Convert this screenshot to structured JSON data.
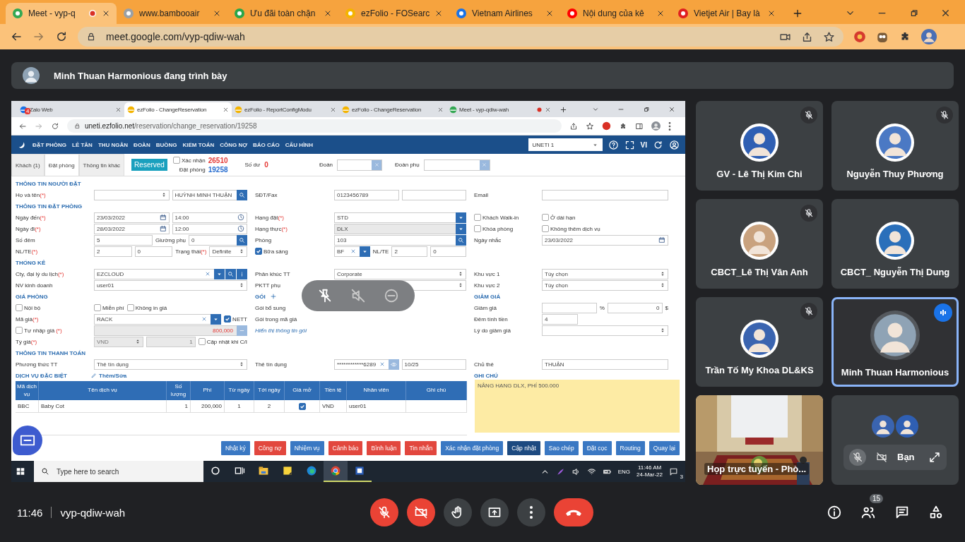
{
  "browser": {
    "tabs": [
      {
        "title": "Meet - vyp-q",
        "selected": true,
        "recording": true
      },
      {
        "title": "www.bambooair",
        "selected": false,
        "recording": false
      },
      {
        "title": "Ưu đãi toàn chặn",
        "selected": false,
        "recording": false
      },
      {
        "title": "ezFolio - FOSearc",
        "selected": false,
        "recording": false
      },
      {
        "title": "Vietnam Airlines",
        "selected": false,
        "recording": false
      },
      {
        "title": "Nội dung của kê",
        "selected": false,
        "recording": false
      },
      {
        "title": "Vietjet Air | Bay là",
        "selected": false,
        "recording": false
      }
    ],
    "url": "meet.google.com/vyp-qdiw-wah"
  },
  "presenter_banner": "Minh Thuan Harmonious đang trình bày",
  "shared_screen": {
    "browser": {
      "tabs": [
        {
          "title": "Zalo Web",
          "selected": false,
          "badge": "4",
          "recording": false
        },
        {
          "title": "ezFolio - ChangeReservation",
          "selected": true,
          "recording": false
        },
        {
          "title": "ezFolio - ReportConfigModu",
          "selected": false,
          "recording": false
        },
        {
          "title": "ezFolio - ChangeReservation",
          "selected": false,
          "recording": false
        },
        {
          "title": "Meet - vyp-qdiw-wah",
          "selected": false,
          "recording": true
        }
      ],
      "url_host": "uneti.ezfolio.net",
      "url_path": "/reservation/change_reservation/19258"
    },
    "nav": {
      "menu": [
        "ĐẶT PHÒNG",
        "LỄ TÂN",
        "THU NGÂN",
        "ĐOÀN",
        "BUỒNG",
        "KIỂM TOÁN",
        "CÔNG NỢ",
        "BÁO CÁO",
        "CẤU HÌNH"
      ],
      "property": "UNETI 1",
      "language": "VI"
    },
    "tabs": [
      {
        "label": "Khách (1)",
        "selected": false
      },
      {
        "label": "Đặt phòng",
        "selected": true
      },
      {
        "label": "Thông tin khác",
        "selected": false
      }
    ],
    "status": "Reserved",
    "confirm": {
      "label": "Xác nhận",
      "checked": false,
      "value": "26510"
    },
    "booking": {
      "label": "Đặt phòng",
      "value": "19258"
    },
    "balance": {
      "label": "Số dư",
      "value": "0"
    },
    "group_label": "Đoàn",
    "subgroup_label": "Đoàn phụ",
    "form": [
      {
        "left": {
          "label": {
            "kind": "section",
            "text": "THÔNG TIN NGƯỜI ĐẶT"
          }
        }
      },
      {
        "left": {
          "label": {
            "kind": "label",
            "text": "Họ và tên",
            "required": "(*)"
          },
          "controls": [
            {
              "kind": "select"
            },
            {
              "kind": "input",
              "value": "HUỲNH MINH THUẬN",
              "buttons": [
                {
                  "kind": "search"
                }
              ]
            }
          ]
        },
        "middle": {
          "label": {
            "kind": "label",
            "text": "SĐT/Fax"
          },
          "controls": [
            {
              "kind": "input",
              "value": "0123456789"
            },
            {
              "kind": "input"
            }
          ]
        },
        "right": {
          "label": {
            "kind": "label",
            "text": "Email"
          },
          "controls": [
            {
              "kind": "input"
            }
          ]
        }
      },
      {
        "left": {
          "label": {
            "kind": "section",
            "text": "THÔNG TIN ĐẶT PHÒNG"
          }
        }
      },
      {
        "left": {
          "label": {
            "kind": "label",
            "text": "Ngày đến",
            "required": "(*)"
          },
          "controls": [
            {
              "kind": "date",
              "value": "23/03/2022"
            },
            {
              "kind": "time",
              "value": "14:00"
            }
          ]
        },
        "middle": {
          "label": {
            "kind": "label",
            "text": "Hạng đặt",
            "required": "(*)"
          },
          "controls": [
            {
              "kind": "input",
              "value": "STD",
              "buttons": [
                {
                  "kind": "dropdown"
                }
              ]
            }
          ]
        },
        "right": {
          "label": {
            "kind": "checkbox",
            "text": "Khách Walk-in",
            "checked": false
          },
          "controls": [
            {
              "kind": "checkbox",
              "text": "Ở dài hạn",
              "checked": false
            }
          ]
        }
      },
      {
        "left": {
          "label": {
            "kind": "label",
            "text": "Ngày đi",
            "required": "(*)"
          },
          "controls": [
            {
              "kind": "date",
              "value": "28/03/2022"
            },
            {
              "kind": "time",
              "value": "12:00"
            }
          ]
        },
        "middle": {
          "label": {
            "kind": "label",
            "text": "Hạng thực",
            "required": "(*)"
          },
          "controls": [
            {
              "kind": "input",
              "value": "DLX",
              "readonly": true,
              "buttons": [
                {
                  "kind": "dropdown"
                }
              ]
            }
          ]
        },
        "right": {
          "label": {
            "kind": "checkbox",
            "text": "Khóa phòng",
            "checked": false
          },
          "controls": [
            {
              "kind": "checkbox",
              "text": "Không thêm dịch vụ",
              "checked": false
            }
          ]
        }
      },
      {
        "left": {
          "label": {
            "kind": "label",
            "text": "Số đêm"
          },
          "controls": [
            {
              "kind": "input",
              "value": "5"
            },
            {
              "kind": "text",
              "text": "Giường phụ"
            },
            {
              "kind": "input",
              "value": "0",
              "buttons": [
                {
                  "kind": "search"
                }
              ]
            }
          ]
        },
        "middle": {
          "label": {
            "kind": "label",
            "text": "Phòng"
          },
          "controls": [
            {
              "kind": "input",
              "value": "103",
              "buttons": [
                {
                  "kind": "search"
                }
              ]
            }
          ]
        },
        "right": {
          "label": {
            "kind": "label",
            "text": "Ngày nhắc"
          },
          "controls": [
            {
              "kind": "date",
              "value": "23/03/2022"
            }
          ]
        }
      },
      {
        "left": {
          "label": {
            "kind": "label",
            "text": "NL/TE",
            "required": "(*)"
          },
          "controls": [
            {
              "kind": "input",
              "value": "2"
            },
            {
              "kind": "input",
              "value": "0"
            },
            {
              "kind": "text",
              "text": "Trạng thái",
              "required": "(*)"
            },
            {
              "kind": "select",
              "value": "Definite"
            }
          ]
        },
        "middle": {
          "label": {
            "kind": "checkbox",
            "text": "Bữa sáng",
            "checked": true
          },
          "controls": [
            {
              "kind": "input",
              "value": "BF",
              "clear": true,
              "buttons": [
                {
                  "kind": "dropdown"
                }
              ]
            },
            {
              "kind": "text",
              "text": "NL/TE"
            },
            {
              "kind": "input",
              "value": "2"
            },
            {
              "kind": "input",
              "value": "0"
            }
          ]
        }
      },
      {
        "left": {
          "label": {
            "kind": "section",
            "text": "THỐNG KÊ"
          }
        }
      },
      {
        "left": {
          "label": {
            "kind": "label",
            "text": "Cty, đại lý du lịch",
            "required": "(*)"
          },
          "controls": [
            {
              "kind": "input",
              "value": "EZCLOUD",
              "clear": true,
              "buttons": [
                {
                  "kind": "dropdown"
                },
                {
                  "kind": "search"
                },
                {
                  "kind": "info"
                }
              ]
            }
          ]
        },
        "middle": {
          "label": {
            "kind": "label",
            "text": "Phân khúc TT"
          },
          "controls": [
            {
              "kind": "select",
              "value": "Corporate"
            }
          ]
        },
        "right": {
          "label": {
            "kind": "label",
            "text": "Khu vực 1"
          },
          "controls": [
            {
              "kind": "select",
              "value": "Tùy chọn"
            }
          ]
        }
      },
      {
        "left": {
          "label": {
            "kind": "label",
            "text": "NV kinh doanh"
          },
          "controls": [
            {
              "kind": "select",
              "value": "user01"
            }
          ]
        },
        "middle": {
          "label": {
            "kind": "label",
            "text": "PKTT phụ"
          },
          "controls": [
            {
              "kind": "select"
            }
          ]
        },
        "right": {
          "label": {
            "kind": "label",
            "text": "Khu vực 2"
          },
          "controls": [
            {
              "kind": "select",
              "value": "Tùy chọn"
            }
          ]
        }
      },
      {
        "left": {
          "label": {
            "kind": "section",
            "text": "GIÁ PHÒNG"
          }
        },
        "middle": {
          "label": {
            "kind": "section",
            "text": "GÓI",
            "add": true
          }
        },
        "right": {
          "label": {
            "kind": "section",
            "text": "GIẢM GIÁ"
          }
        }
      },
      {
        "left": {
          "label": {
            "kind": "checkbox",
            "text": "Nội bộ",
            "checked": false
          },
          "controls": [
            {
              "kind": "checkbox",
              "text": "Miễn phí",
              "checked": false
            },
            {
              "kind": "checkbox",
              "text": "Không in giá",
              "checked": false
            }
          ]
        },
        "middle": {
          "label": {
            "kind": "label",
            "text": "Gói bổ sung"
          }
        },
        "right": {
          "label": {
            "kind": "label",
            "text": "Giảm giá"
          },
          "controls": [
            {
              "kind": "input"
            },
            {
              "kind": "text",
              "text": "%"
            },
            {
              "kind": "amount",
              "value": "0"
            },
            {
              "kind": "text",
              "text": "$"
            }
          ]
        }
      },
      {
        "left": {
          "label": {
            "kind": "label",
            "text": "Mã giá",
            "required": "(*)"
          },
          "controls": [
            {
              "kind": "input",
              "value": "RACK",
              "clear": true,
              "buttons": [
                {
                  "kind": "dropdown"
                }
              ]
            },
            {
              "kind": "checkbox",
              "text": "NETT",
              "checked": true
            }
          ]
        },
        "middle": {
          "label": {
            "kind": "label",
            "text": "Gói trong mã giá"
          }
        },
        "right": {
          "label": {
            "kind": "label",
            "text": "Đêm tính tiền"
          },
          "controls": [
            {
              "kind": "input",
              "value": "4"
            },
            {
              "kind": "gap"
            }
          ]
        }
      },
      {
        "left": {
          "label": {
            "kind": "checkbox",
            "text": "Tự nhập giá",
            "required": "(*)",
            "checked": false
          },
          "controls": [
            {
              "kind": "amount",
              "value": "800,000",
              "disabled": true,
              "emphasis": true,
              "buttons": [
                {
                  "kind": "minus"
                }
              ]
            }
          ]
        },
        "middle": {
          "label": {
            "kind": "link",
            "text": "Hiển thị thông tin gói"
          }
        },
        "right": {
          "label": {
            "kind": "label",
            "text": "Lý do giảm giá"
          },
          "controls": [
            {
              "kind": "select"
            }
          ]
        }
      },
      {
        "left": {
          "label": {
            "kind": "label",
            "text": "Tỷ giá",
            "required": "(*)"
          },
          "controls": [
            {
              "kind": "select",
              "value": "VND",
              "disabled": true
            },
            {
              "kind": "amount",
              "value": "1",
              "disabled": true
            },
            {
              "kind": "checkbox",
              "text": "Cập nhật khi C/I",
              "checked": false
            }
          ]
        }
      },
      {
        "left": {
          "label": {
            "kind": "section",
            "text": "THÔNG TIN THANH TOÁN"
          }
        }
      },
      {
        "left": {
          "label": {
            "kind": "label",
            "text": "Phương thức TT"
          },
          "controls": [
            {
              "kind": "select",
              "value": "Thẻ tín dụng"
            }
          ]
        },
        "middle": {
          "label": {
            "kind": "label",
            "text": "Thẻ tín dụng"
          },
          "controls": [
            {
              "kind": "input",
              "value": "************6289",
              "clear": true,
              "buttons": [
                {
                  "kind": "eye"
                }
              ]
            },
            {
              "kind": "input",
              "value": "10/25"
            }
          ]
        },
        "right": {
          "label": {
            "kind": "label",
            "text": "Chủ thẻ"
          },
          "controls": [
            {
              "kind": "input",
              "value": "THUẬN"
            }
          ]
        }
      },
      {
        "left": {
          "label": {
            "kind": "section",
            "text": "DỊCH VỤ ĐẶC BIỆT"
          },
          "controls": [
            {
              "kind": "edit_link",
              "text": "Thêm/Sửa"
            }
          ]
        },
        "right": {
          "label": {
            "kind": "section",
            "text": "GHI CHÚ"
          }
        }
      }
    ],
    "services": {
      "columns": [
        "Mã dịch vụ",
        "Tên dịch vụ",
        "Số lượng",
        "Phí",
        "Từ ngày",
        "Tới ngày",
        "Giá mở",
        "Tiền tệ",
        "Nhân viên",
        "Ghi chú"
      ],
      "rows": [
        {
          "code": "BBC",
          "name": "Baby Cot",
          "quantity": "1",
          "fee": "200,000",
          "from_day": "1",
          "to_day": "2",
          "open_price": true,
          "currency": "VND",
          "staff": "user01"
        }
      ]
    },
    "note": "NÂNG HẠNG DLX, PHÍ 500.000",
    "actions": [
      {
        "label": "Nhật ký",
        "color": "#3a78c3"
      },
      {
        "label": "Công nợ",
        "color": "#e2473e"
      },
      {
        "label": "Nhiệm vụ",
        "color": "#3a78c3"
      },
      {
        "label": "Cảnh báo",
        "color": "#e2473e"
      },
      {
        "label": "Bình luận",
        "color": "#e2473e"
      },
      {
        "label": "Tin nhắn",
        "color": "#e2473e"
      },
      {
        "label": "Xác nhận đặt phòng",
        "color": "#3a78c3"
      },
      {
        "label": "Cập nhật",
        "color": "#1d4a80"
      },
      {
        "label": "Sao chép",
        "color": "#3a78c3"
      },
      {
        "label": "Đặt cọc",
        "color": "#3a78c3"
      },
      {
        "label": "Routing",
        "color": "#3a78c3"
      },
      {
        "label": "Quay lại",
        "color": "#3a78c3"
      }
    ],
    "taskbar": {
      "search_placeholder": "Type here to search",
      "apps": [
        {
          "kind": "cortana",
          "active": false,
          "running": false
        },
        {
          "kind": "task_view",
          "active": false,
          "running": false
        },
        {
          "kind": "explorer",
          "active": false,
          "running": false
        },
        {
          "kind": "sticky_notes",
          "active": false,
          "running": false
        },
        {
          "kind": "edge",
          "active": false,
          "running": false
        },
        {
          "kind": "chrome",
          "active": true,
          "running": true
        },
        {
          "kind": "word",
          "active": false,
          "running": true
        }
      ],
      "language": "ENG",
      "time": "11:46 AM",
      "date": "24-Mar-22",
      "notifications": "3"
    }
  },
  "participants": [
    {
      "kind": "avatar",
      "name": "GV - Lê Thị Kim Chi",
      "muted": true,
      "speaking": false
    },
    {
      "kind": "avatar",
      "name": "Nguyễn Thuy Phương",
      "muted": true,
      "speaking": false
    },
    {
      "kind": "avatar",
      "name": "CBCT_Lê Thị Vân Anh",
      "muted": true,
      "speaking": false
    },
    {
      "kind": "avatar",
      "name": "CBCT_ Nguyễn Thị Dung",
      "muted": false,
      "speaking": false
    },
    {
      "kind": "avatar",
      "name": "Trần Tố My Khoa DL&KS",
      "muted": true,
      "speaking": false
    },
    {
      "kind": "avatar",
      "name": "Minh Thuan Harmonious",
      "muted": false,
      "speaking": true
    },
    {
      "kind": "video",
      "name": "Họp trực tuyến - Phò..."
    },
    {
      "kind": "self",
      "name": "Bạn",
      "microphone_on": false,
      "camera_on": false
    }
  ],
  "meeting": {
    "time": "11:46",
    "code": "vyp-qdiw-wah",
    "controls": [
      {
        "kind": "microphone",
        "on": false
      },
      {
        "kind": "camera",
        "on": false
      },
      {
        "kind": "raise_hand"
      },
      {
        "kind": "present"
      },
      {
        "kind": "more"
      },
      {
        "kind": "leave"
      }
    ],
    "side_buttons": [
      {
        "kind": "info"
      },
      {
        "kind": "people",
        "badge": "15"
      },
      {
        "kind": "chat"
      },
      {
        "kind": "activities"
      }
    ]
  }
}
